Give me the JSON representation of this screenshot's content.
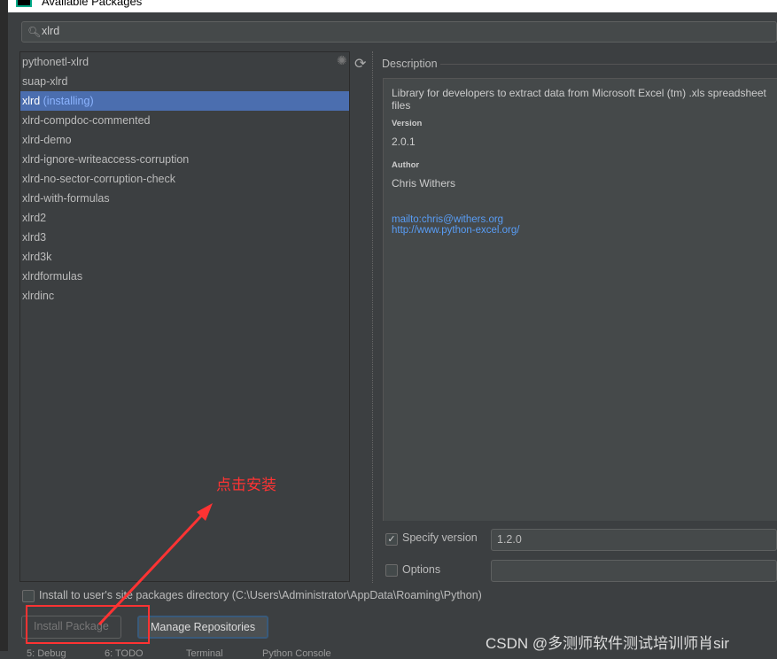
{
  "window": {
    "title": "Available Packages"
  },
  "search": {
    "value": "xlrd"
  },
  "packages": [
    {
      "name": "pythonetl-xlrd"
    },
    {
      "name": "suap-xlrd"
    },
    {
      "name": "xlrd",
      "note": "(installing)",
      "selected": true
    },
    {
      "name": "xlrd-compdoc-commented"
    },
    {
      "name": "xlrd-demo"
    },
    {
      "name": "xlrd-ignore-writeaccess-corruption"
    },
    {
      "name": "xlrd-no-sector-corruption-check"
    },
    {
      "name": "xlrd-with-formulas"
    },
    {
      "name": "xlrd2"
    },
    {
      "name": "xlrd3"
    },
    {
      "name": "xlrd3k"
    },
    {
      "name": "xlrdformulas"
    },
    {
      "name": "xlrdinc"
    }
  ],
  "description": {
    "header": "Description",
    "summary": "Library for developers to extract data from Microsoft Excel (tm) .xls spreadsheet files",
    "version_label": "Version",
    "version": "2.0.1",
    "author_label": "Author",
    "author": "Chris Withers",
    "links": [
      "mailto:chris@withers.org",
      "http://www.python-excel.org/"
    ]
  },
  "options": {
    "specify_version_label": "Specify version",
    "specify_version_checked": true,
    "version_value": "1.2.0",
    "options_label": "Options",
    "options_checked": false,
    "options_value": "",
    "user_site_label": "Install to user's site packages directory (C:\\Users\\Administrator\\AppData\\Roaming\\Python)",
    "user_site_checked": false
  },
  "buttons": {
    "install": "Install Package",
    "manage": "Manage Repositories"
  },
  "annotation": {
    "text": "点击安装",
    "color": "#ff3333"
  },
  "watermark": "CSDN @多测师软件测试培训师肖sir",
  "statusbar": [
    "5: Debug",
    "6: TODO",
    "Terminal",
    "Python Console"
  ]
}
